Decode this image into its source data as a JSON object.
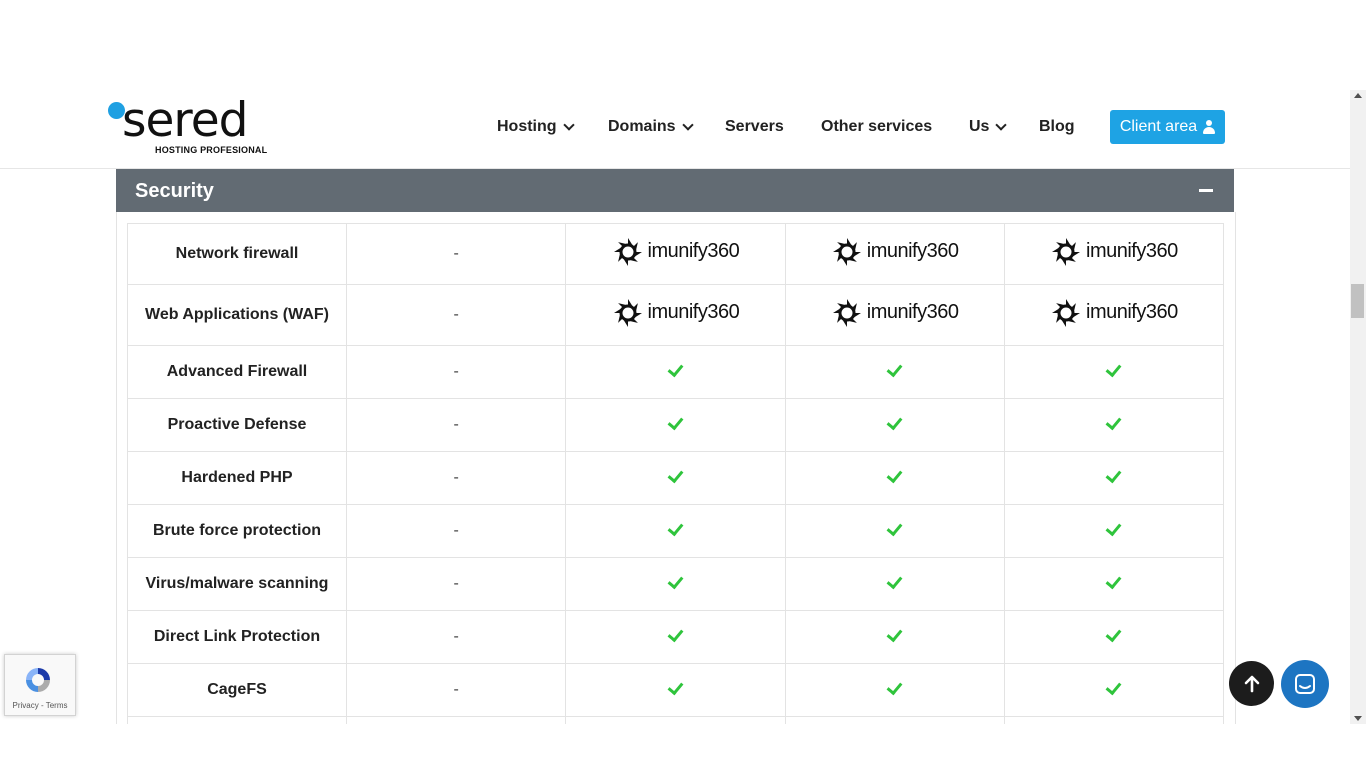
{
  "brand": {
    "name": "sered",
    "tagline": "HOSTING PROFESIONAL",
    "accent": "#1fa0e2"
  },
  "nav": {
    "items": [
      {
        "label": "Hosting",
        "dropdown": true
      },
      {
        "label": "Domains",
        "dropdown": true
      },
      {
        "label": "Servers",
        "dropdown": false
      },
      {
        "label": "Other services",
        "dropdown": false
      },
      {
        "label": "Us",
        "dropdown": true
      },
      {
        "label": "Blog",
        "dropdown": false
      }
    ],
    "client_area": "Client area"
  },
  "section": {
    "title": "Security",
    "toggle": "collapse-minus"
  },
  "table": {
    "logo_text": "imunify360",
    "rows": [
      {
        "feature": "Network firewall",
        "plan1": "-",
        "plans": [
          "imunify360",
          "imunify360",
          "imunify360"
        ]
      },
      {
        "feature": "Web Applications (WAF)",
        "plan1": "-",
        "plans": [
          "imunify360",
          "imunify360",
          "imunify360"
        ]
      },
      {
        "feature": "Advanced Firewall",
        "plan1": "-",
        "plans": [
          "check",
          "check",
          "check"
        ]
      },
      {
        "feature": "Proactive Defense",
        "plan1": "-",
        "plans": [
          "check",
          "check",
          "check"
        ]
      },
      {
        "feature": "Hardened PHP",
        "plan1": "-",
        "plans": [
          "check",
          "check",
          "check"
        ]
      },
      {
        "feature": "Brute force protection",
        "plan1": "-",
        "plans": [
          "check",
          "check",
          "check"
        ]
      },
      {
        "feature": "Virus/malware scanning",
        "plan1": "-",
        "plans": [
          "check",
          "check",
          "check"
        ]
      },
      {
        "feature": "Direct Link Protection",
        "plan1": "-",
        "plans": [
          "check",
          "check",
          "check"
        ]
      },
      {
        "feature": "CageFS",
        "plan1": "-",
        "plans": [
          "check",
          "check",
          "check"
        ]
      }
    ]
  },
  "recaptcha": {
    "privacy": "Privacy",
    "separator": " - ",
    "terms": "Terms"
  },
  "colors": {
    "check": "#2fc43c",
    "section_bg": "#626b73",
    "client_btn": "#1ea3e4",
    "chat_btn": "#1d75c2"
  }
}
